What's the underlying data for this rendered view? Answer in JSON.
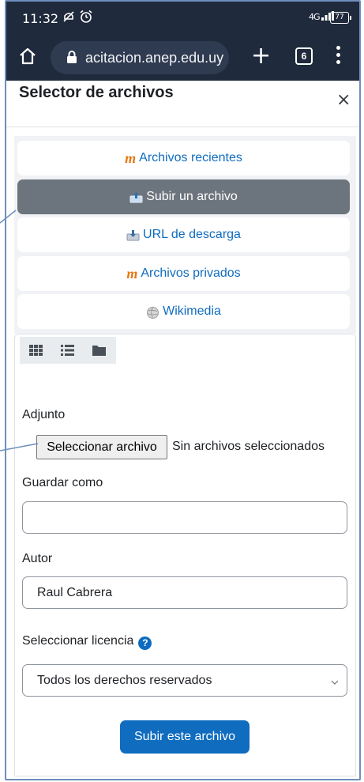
{
  "status_bar": {
    "time": "11:32",
    "network": "4G",
    "battery": "77"
  },
  "browser": {
    "url": "acitacion.anep.edu.uy",
    "tab_count": "6"
  },
  "dialog": {
    "title": "Selector de archivos",
    "close_symbol": "×",
    "repositories": [
      {
        "label": "Archivos recientes",
        "icon": "moodle-icon",
        "active": false
      },
      {
        "label": "Subir un archivo",
        "icon": "upload-icon",
        "active": true
      },
      {
        "label": "URL de descarga",
        "icon": "download-url-icon",
        "active": false
      },
      {
        "label": "Archivos privados",
        "icon": "moodle-icon",
        "active": false
      },
      {
        "label": "Wikimedia",
        "icon": "wikimedia-icon",
        "active": false
      }
    ],
    "view_modes": [
      "grid-view-icon",
      "list-view-icon",
      "folder-view-icon"
    ]
  },
  "form": {
    "attachment_label": "Adjunto",
    "file_button": "Seleccionar archivo",
    "file_status": "Sin archivos seleccionados",
    "save_as_label": "Guardar como",
    "save_as_value": "",
    "author_label": "Autor",
    "author_value": "Raul Cabrera",
    "license_label": "Seleccionar licencia",
    "license_value": "Todos los derechos reservados",
    "submit_label": "Subir este archivo"
  },
  "colors": {
    "primary": "#0f6cbf",
    "active_repo": "#6c757d",
    "moodle_orange": "#e47812",
    "browser_bar": "#1f2a3c"
  }
}
